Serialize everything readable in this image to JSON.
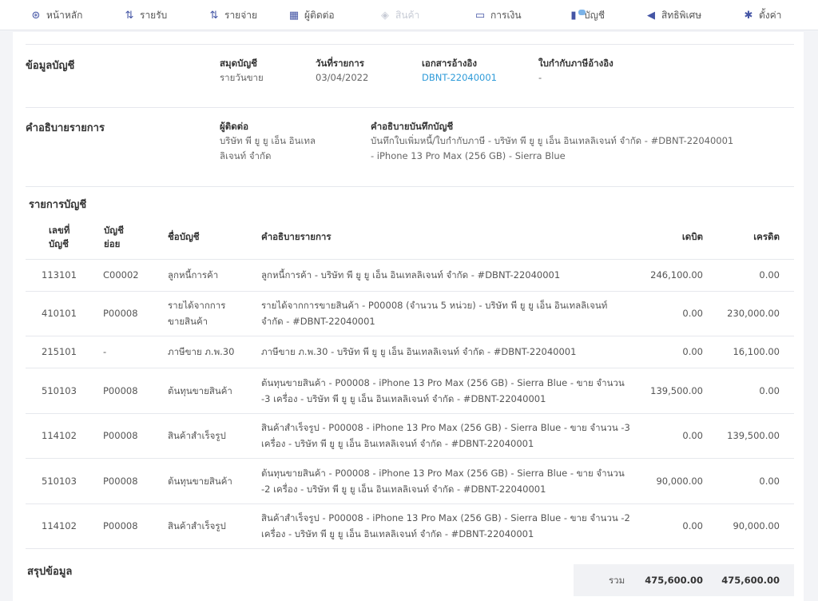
{
  "nav": [
    {
      "label": "หน้าหลัก",
      "icon": "⊛"
    },
    {
      "label": "รายรับ",
      "icon": "⇅"
    },
    {
      "label": "รายจ่าย",
      "icon": "⇅"
    },
    {
      "label": "ผู้ติดต่อ",
      "icon": "▦"
    },
    {
      "label": "สินค้า",
      "icon": "◈"
    },
    {
      "label": "การเงิน",
      "icon": "▭"
    },
    {
      "label": "บัญชี",
      "icon": "▮"
    },
    {
      "label": "สิทธิพิเศษ",
      "icon": "◀"
    },
    {
      "label": "ตั้งค่า",
      "icon": "✱"
    }
  ],
  "info": {
    "title": "ข้อมูลบัญชี",
    "journal_label": "สมุดบัญชี",
    "journal_value": "รายวันขาย",
    "date_label": "วันที่รายการ",
    "date_value": "03/04/2022",
    "ref_doc_label": "เอกสารอ้างอิง",
    "ref_doc_value": "DBNT-22040001",
    "tax_ref_label": "ใบกำกับภาษีอ้างอิง",
    "tax_ref_value": "-"
  },
  "desc": {
    "title": "คำอธิบายรายการ",
    "contact_label": "ผู้ติดต่อ",
    "contact_line1": "บริษัท พี ยู ยู เอ็น อินเทล",
    "contact_line2": "ลิเจนท์ จำกัด",
    "note_label": "คำอธิบายบันทึกบัญชี",
    "note_line1": "บันทึกใบเพิ่มหนี้/ใบกำกับภาษี - บริษัท พี ยู ยู เอ็น อินเทลลิเจนท์ จำกัด - #DBNT-22040001",
    "note_line2": "- iPhone 13 Pro Max (256 GB) - Sierra Blue"
  },
  "ledger": {
    "title": "รายการบัญชี",
    "headers": {
      "acc_no_1": "เลขที่",
      "acc_no_2": "บัญชี",
      "sub_1": "บัญชี",
      "sub_2": "ย่อย",
      "name": "ชื่อบัญชี",
      "desc": "คำอธิบายรายการ",
      "debit": "เดบิต",
      "credit": "เครดิต"
    },
    "rows": [
      {
        "acc": "113101",
        "sub": "C00002",
        "name1": "ลูกหนี้การค้า",
        "name2": "",
        "d1": "ลูกหนี้การค้า - บริษัท พี ยู ยู เอ็น อินเทลลิเจนท์ จำกัด - #DBNT-22040001",
        "d2": "",
        "debit": "246,100.00",
        "credit": "0.00"
      },
      {
        "acc": "410101",
        "sub": "P00008",
        "name1": "รายได้จากการ",
        "name2": "ขายสินค้า",
        "d1": "รายได้จากการขายสินค้า - P00008 (จำนวน 5 หน่วย) - บริษัท พี ยู ยู เอ็น อินเทลลิเจนท์",
        "d2": "จำกัด - #DBNT-22040001",
        "debit": "0.00",
        "credit": "230,000.00"
      },
      {
        "acc": "215101",
        "sub": "-",
        "name1": "ภาษีขาย ภ.พ.30",
        "name2": "",
        "d1": "ภาษีขาย ภ.พ.30 - บริษัท พี ยู ยู เอ็น อินเทลลิเจนท์ จำกัด - #DBNT-22040001",
        "d2": "",
        "debit": "0.00",
        "credit": "16,100.00"
      },
      {
        "acc": "510103",
        "sub": "P00008",
        "name1": "ต้นทุนขายสินค้า",
        "name2": "",
        "d1": "ต้นทุนขายสินค้า - P00008 - iPhone 13 Pro Max (256 GB) - Sierra Blue - ขาย จำนวน",
        "d2": "-3 เครื่อง - บริษัท พี ยู ยู เอ็น อินเทลลิเจนท์ จำกัด - #DBNT-22040001",
        "debit": "139,500.00",
        "credit": "0.00"
      },
      {
        "acc": "114102",
        "sub": "P00008",
        "name1": "สินค้าสำเร็จรูป",
        "name2": "",
        "d1": "สินค้าสำเร็จรูป - P00008 - iPhone 13 Pro Max (256 GB) - Sierra Blue - ขาย จำนวน -3",
        "d2": "เครื่อง - บริษัท พี ยู ยู เอ็น อินเทลลิเจนท์ จำกัด - #DBNT-22040001",
        "debit": "0.00",
        "credit": "139,500.00"
      },
      {
        "acc": "510103",
        "sub": "P00008",
        "name1": "ต้นทุนขายสินค้า",
        "name2": "",
        "d1": "ต้นทุนขายสินค้า - P00008 - iPhone 13 Pro Max (256 GB) - Sierra Blue - ขาย จำนวน",
        "d2": "-2 เครื่อง - บริษัท พี ยู ยู เอ็น อินเทลลิเจนท์ จำกัด - #DBNT-22040001",
        "debit": "90,000.00",
        "credit": "0.00"
      },
      {
        "acc": "114102",
        "sub": "P00008",
        "name1": "สินค้าสำเร็จรูป",
        "name2": "",
        "d1": "สินค้าสำเร็จรูป - P00008 - iPhone 13 Pro Max (256 GB) - Sierra Blue - ขาย จำนวน -2",
        "d2": "เครื่อง - บริษัท พี ยู ยู เอ็น อินเทลลิเจนท์ จำกัด - #DBNT-22040001",
        "debit": "0.00",
        "credit": "90,000.00"
      }
    ]
  },
  "summary": {
    "title": "สรุปข้อมูล",
    "total_label": "รวม",
    "total_debit": "475,600.00",
    "total_credit": "475,600.00"
  }
}
